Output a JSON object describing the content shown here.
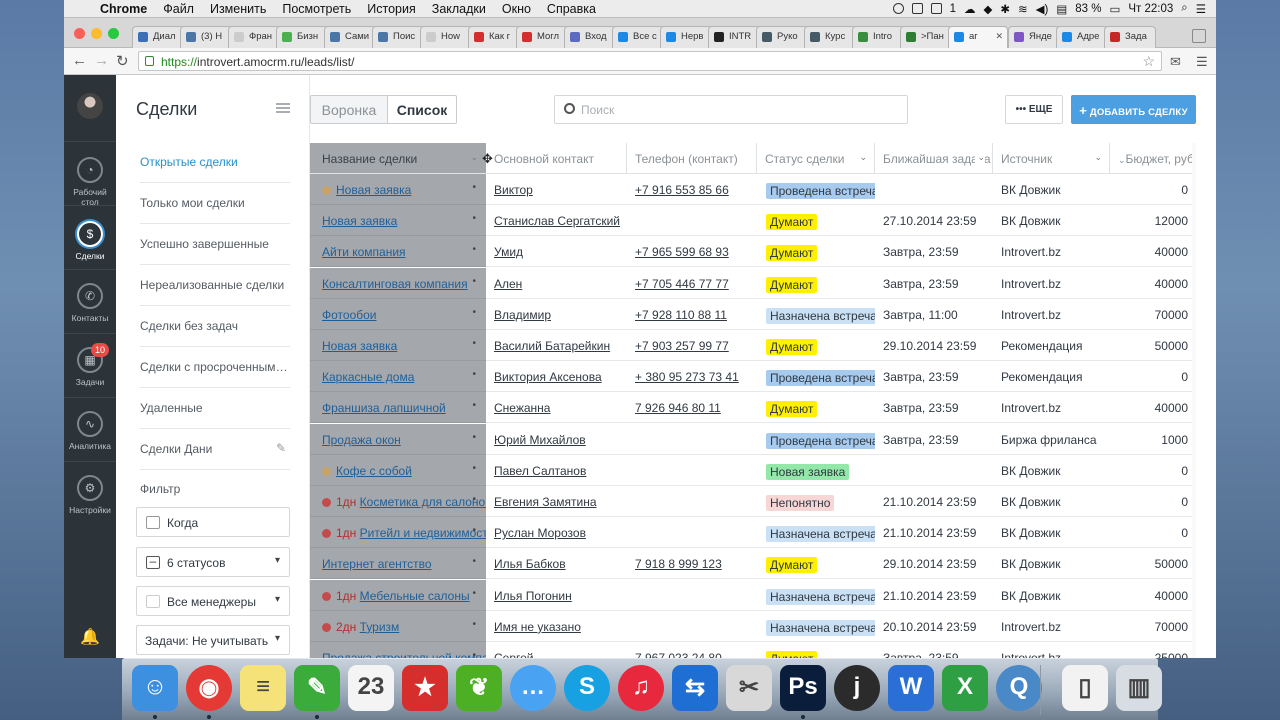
{
  "menubar": {
    "items": [
      "Chrome",
      "Файл",
      "Изменить",
      "Посмотреть",
      "История",
      "Закладки",
      "Окно",
      "Справка"
    ],
    "battery": "83 %",
    "clock": "Чт 22:03",
    "status_one": "1"
  },
  "tabs": [
    {
      "label": "Диал",
      "color": "#3b6fb6"
    },
    {
      "label": "(3) Н",
      "color": "#4a76a8"
    },
    {
      "label": "Фран",
      "color": "#cccccc"
    },
    {
      "label": "Бизн",
      "color": "#4caf50"
    },
    {
      "label": "Сами",
      "color": "#4a76a8"
    },
    {
      "label": "Поис",
      "color": "#4a76a8"
    },
    {
      "label": "How",
      "color": "#cccccc"
    },
    {
      "label": "Как г",
      "color": "#d32f2f"
    },
    {
      "label": "Могл",
      "color": "#d32f2f"
    },
    {
      "label": "Вход",
      "color": "#5c6bc0"
    },
    {
      "label": "Все с",
      "color": "#1e88e5"
    },
    {
      "label": "Нерв",
      "color": "#1e88e5"
    },
    {
      "label": "INTR",
      "color": "#222222"
    },
    {
      "label": "Руко",
      "color": "#455a64"
    },
    {
      "label": "Курс",
      "color": "#455a64"
    },
    {
      "label": "Intro",
      "color": "#388e3c"
    },
    {
      "label": ">Пан",
      "color": "#2e7d32"
    },
    {
      "label": "аг",
      "color": "#1e88e5"
    },
    {
      "label": "Янде",
      "color": "#7e57c2"
    },
    {
      "label": "Адре",
      "color": "#1e88e5"
    },
    {
      "label": "Зада",
      "color": "#c62828"
    }
  ],
  "address": {
    "scheme": "https://",
    "rest": "introvert.amocrm.ru/leads/list/"
  },
  "rail": {
    "items": [
      {
        "line1": "Рабочий",
        "line2": "стол",
        "icon": "gauge-icon",
        "glyph": "◔"
      },
      {
        "line1": "Сделки",
        "line2": "",
        "icon": "dollar-icon",
        "glyph": "$"
      },
      {
        "line1": "Контакты",
        "line2": "",
        "icon": "phone-icon",
        "glyph": "✆"
      },
      {
        "line1": "Задачи",
        "line2": "",
        "icon": "calendar-icon",
        "glyph": "▦",
        "badge": "10"
      },
      {
        "line1": "Аналитика",
        "line2": "",
        "icon": "chart-icon",
        "glyph": "∿"
      },
      {
        "line1": "Настройки",
        "line2": "",
        "icon": "gear-icon",
        "glyph": "⚙"
      }
    ],
    "bell_glyph": "🔔"
  },
  "sidebar": {
    "title": "Сделки",
    "items": [
      "Открытые сделки",
      "Только мои сделки",
      "Успешно завершенные",
      "Нереализованные сделки",
      "Сделки без задач",
      "Сделки с просроченными задачами",
      "Удаленные",
      "Сделки Дани"
    ],
    "filter_label": "Фильтр",
    "filters": [
      "Когда",
      "6 статусов",
      "Все менеджеры",
      "Задачи: Не учитывать"
    ]
  },
  "toolbar": {
    "seg_funnel": "Воронка",
    "seg_list": "Список",
    "search_placeholder": "Поиск",
    "more": "ЕЩЕ",
    "add": "ДОБАВИТЬ СДЕЛКУ"
  },
  "columns": [
    "Название сделки",
    "Основной контакт",
    "Телефон (контакт)",
    "Статус сделки",
    "Ближайшая задача",
    "Источник",
    "Бюджет, руб"
  ],
  "rows": [
    {
      "name": "Новая заявка",
      "dot": "#c8a36a",
      "late": "",
      "contact": "Виктор",
      "phone": "+7 916 553 85 66",
      "status": "Проведена встреча",
      "scolor": "#a7cbee",
      "task": "",
      "source": "ВК Довжик",
      "budget": "0"
    },
    {
      "name": "Новая заявка",
      "dot": "",
      "late": "",
      "contact": "Станислав Сергатский",
      "phone": "",
      "status": "Думают",
      "scolor": "#fff000",
      "task": "27.10.2014 23:59",
      "source": "ВК Довжик",
      "budget": "12000"
    },
    {
      "name": "Айти компания",
      "dot": "",
      "late": "",
      "contact": "Умид",
      "phone": "+7 965 599 68 93",
      "status": "Думают",
      "scolor": "#fff000",
      "task": "Завтра, 23:59",
      "source": "Introvert.bz",
      "budget": "40000"
    },
    {
      "name": "Консалтинговая компания",
      "dot": "",
      "late": "",
      "contact": "Ален",
      "phone": "+7 705 446 77 77",
      "status": "Думают",
      "scolor": "#fff000",
      "task": "Завтра, 23:59",
      "source": "Introvert.bz",
      "budget": "40000"
    },
    {
      "name": "Фотообои",
      "dot": "",
      "late": "",
      "contact": "Владимир",
      "phone": "+7 928 110 88 11",
      "status": "Назначена встреча",
      "scolor": "#c9e0f5",
      "task": "Завтра, 11:00",
      "source": "Introvert.bz",
      "budget": "70000"
    },
    {
      "name": "Новая заявка",
      "dot": "",
      "late": "",
      "contact": "Василий Батарейкин",
      "phone": "+7 903 257 99 77",
      "status": "Думают",
      "scolor": "#fff000",
      "task": "29.10.2014 23:59",
      "source": "Рекомендация",
      "budget": "50000"
    },
    {
      "name": "Каркасные дома",
      "dot": "",
      "late": "",
      "contact": "Виктория Аксенова",
      "phone": "+ 380 95 273 73 41",
      "status": "Проведена встреча",
      "scolor": "#a7cbee",
      "task": "Завтра, 23:59",
      "source": "Рекомендация",
      "budget": "0"
    },
    {
      "name": "Франшиза лапшичной",
      "dot": "",
      "late": "",
      "contact": "Снежанна",
      "phone": "7 926 946 80 11",
      "status": "Думают",
      "scolor": "#fff000",
      "task": "Завтра, 23:59",
      "source": "Introvert.bz",
      "budget": "40000"
    },
    {
      "name": "Продажа окон",
      "dot": "",
      "late": "",
      "contact": "Юрий Михайлов",
      "phone": "",
      "status": "Проведена встреча",
      "scolor": "#a7cbee",
      "task": "Завтра, 23:59",
      "source": "Биржа фриланса",
      "budget": "1000"
    },
    {
      "name": "Кофе с собой",
      "dot": "#c8a36a",
      "late": "",
      "contact": "Павел Салтанов",
      "phone": "",
      "status": "Новая заявка",
      "scolor": "#93e7a9",
      "task": "",
      "source": "ВК Довжик",
      "budget": "0"
    },
    {
      "name": "Косметика для салонов",
      "dot": "#c44b4b",
      "late": "1дн",
      "contact": "Евгения Замятина",
      "phone": "",
      "status": "Непонятно",
      "scolor": "#f7d6d6",
      "task": "21.10.2014 23:59",
      "source": "ВК Довжик",
      "budget": "0"
    },
    {
      "name": "Ритейл и недвижимость",
      "dot": "#c44b4b",
      "late": "1дн",
      "contact": "Руслан Морозов",
      "phone": "",
      "status": "Назначена встреча",
      "scolor": "#c9e0f5",
      "task": "21.10.2014 23:59",
      "source": "ВК Довжик",
      "budget": "0"
    },
    {
      "name": "Интернет агентство",
      "dot": "",
      "late": "",
      "contact": "Илья Бабков",
      "phone": "7 918 8 999 123",
      "status": "Думают",
      "scolor": "#fff000",
      "task": "29.10.2014 23:59",
      "source": "ВК Довжик",
      "budget": "50000"
    },
    {
      "name": "Мебельные салоны",
      "dot": "#c44b4b",
      "late": "1дн",
      "contact": "Илья Погонин",
      "phone": "",
      "status": "Назначена встреча",
      "scolor": "#c9e0f5",
      "task": "21.10.2014 23:59",
      "source": "ВК Довжик",
      "budget": "40000"
    },
    {
      "name": "Туризм",
      "dot": "#c44b4b",
      "late": "2дн",
      "contact": "Имя не указано",
      "phone": "",
      "status": "Назначена встреча",
      "scolor": "#c9e0f5",
      "task": "20.10.2014 23:59",
      "source": "Introvert.bz",
      "budget": "70000"
    },
    {
      "name": "Продажа строительной компании",
      "dot": "",
      "late": "",
      "contact": "Сергей",
      "phone": "7 967 023 24 80",
      "status": "Думают",
      "scolor": "#fff000",
      "task": "Завтра, 23:59",
      "source": "Introvert.bz",
      "budget": "25000"
    }
  ],
  "dock": [
    {
      "name": "finder-icon",
      "glyph": "☺",
      "color": "#3d8fe0"
    },
    {
      "name": "chrome-icon",
      "glyph": "◉",
      "color": "#e53935"
    },
    {
      "name": "notes-icon",
      "glyph": "≡",
      "color": "#f5e37a"
    },
    {
      "name": "evernote-icon",
      "glyph": "✎",
      "color": "#3bab3b"
    },
    {
      "name": "calendar-app-icon",
      "glyph": "23",
      "color": "#f4f4f4"
    },
    {
      "name": "bookmark-app-icon",
      "glyph": "★",
      "color": "#d62d2d"
    },
    {
      "name": "leaf-app-icon",
      "glyph": "❦",
      "color": "#4caf24"
    },
    {
      "name": "messages-icon",
      "glyph": "…",
      "color": "#49a3f2"
    },
    {
      "name": "skype-icon",
      "glyph": "S",
      "color": "#18a1e2"
    },
    {
      "name": "itunes-icon",
      "glyph": "♫",
      "color": "#e8283c"
    },
    {
      "name": "teamviewer-icon",
      "glyph": "⇆",
      "color": "#1f6ed3"
    },
    {
      "name": "tool-app-icon",
      "glyph": "✂",
      "color": "#d8d8d8"
    },
    {
      "name": "photoshop-icon",
      "glyph": "Ps",
      "color": "#0a1e3c"
    },
    {
      "name": "j-app-icon",
      "glyph": "j",
      "color": "#2b2b2b"
    },
    {
      "name": "word-icon",
      "glyph": "W",
      "color": "#2a6fd6"
    },
    {
      "name": "excel-icon",
      "glyph": "X",
      "color": "#2ea043"
    },
    {
      "name": "quicktime-icon",
      "glyph": "Q",
      "color": "#4a89c7"
    },
    {
      "name": "document-icon",
      "glyph": "▯",
      "color": "#f2f2f2"
    },
    {
      "name": "trash-icon",
      "glyph": "▥",
      "color": "#d7dde3"
    }
  ]
}
